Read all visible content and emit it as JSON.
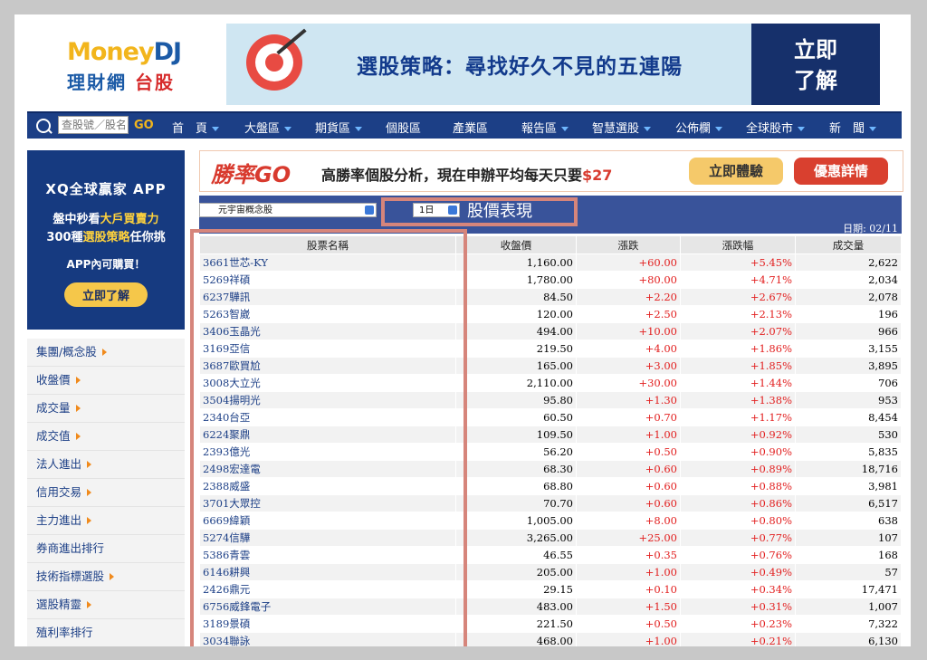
{
  "logo": {
    "money": "Money",
    "dj": "DJ",
    "line2": "理財網",
    "line2b": "台股"
  },
  "banner": {
    "text": "選股策略：尋找好久不見的五連陽",
    "cta": "立即了解"
  },
  "nav": {
    "search_placeholder": "查股號／股名",
    "go": "GO",
    "items": [
      "首　頁",
      "大盤區",
      "期貨區",
      "個股區",
      "產業區",
      "報告區",
      "智慧選股",
      "公佈欄",
      "全球股市",
      "新　聞"
    ]
  },
  "side_ad": {
    "t1": "XQ全球贏家 APP",
    "t2a": "盤中秒看",
    "t2b": "大戶買賣力",
    "t3a": "300種",
    "t3b": "選股策略",
    "t3c": "任你挑",
    "t4": "APP內可購買！",
    "cta": "立即了解"
  },
  "side_menu": [
    "集團/概念股",
    "收盤價",
    "成交量",
    "成交值",
    "法人進出",
    "信用交易",
    "主力進出",
    "券商進出排行",
    "技術指標選股",
    "選股精靈",
    "殖利率排行"
  ],
  "promo": {
    "logo": "勝率GO",
    "text_a": "高勝率個股分析，現在申辦平均每天只要",
    "text_b": "$27",
    "btn1": "立即體驗",
    "btn2": "優惠詳情"
  },
  "table": {
    "concept": "元宇宙概念股",
    "period": "1日",
    "title": "股價表現",
    "date": "日期: 02/11",
    "headers": [
      "股票名稱",
      "收盤價",
      "漲跌",
      "漲跌幅",
      "成交量"
    ],
    "rows": [
      [
        "3661世芯-KY",
        "1,160.00",
        "+60.00",
        "+5.45%",
        "2,622"
      ],
      [
        "5269祥碩",
        "1,780.00",
        "+80.00",
        "+4.71%",
        "2,034"
      ],
      [
        "6237驊訊",
        "84.50",
        "+2.20",
        "+2.67%",
        "2,078"
      ],
      [
        "5263智崴",
        "120.00",
        "+2.50",
        "+2.13%",
        "196"
      ],
      [
        "3406玉晶光",
        "494.00",
        "+10.00",
        "+2.07%",
        "966"
      ],
      [
        "3169亞信",
        "219.50",
        "+4.00",
        "+1.86%",
        "3,155"
      ],
      [
        "3687歐買尬",
        "165.00",
        "+3.00",
        "+1.85%",
        "3,895"
      ],
      [
        "3008大立光",
        "2,110.00",
        "+30.00",
        "+1.44%",
        "706"
      ],
      [
        "3504揚明光",
        "95.80",
        "+1.30",
        "+1.38%",
        "953"
      ],
      [
        "2340台亞",
        "60.50",
        "+0.70",
        "+1.17%",
        "8,454"
      ],
      [
        "6224聚鼎",
        "109.50",
        "+1.00",
        "+0.92%",
        "530"
      ],
      [
        "2393億光",
        "56.20",
        "+0.50",
        "+0.90%",
        "5,835"
      ],
      [
        "2498宏達電",
        "68.30",
        "+0.60",
        "+0.89%",
        "18,716"
      ],
      [
        "2388威盛",
        "68.80",
        "+0.60",
        "+0.88%",
        "3,981"
      ],
      [
        "3701大眾控",
        "70.70",
        "+0.60",
        "+0.86%",
        "6,517"
      ],
      [
        "6669緯穎",
        "1,005.00",
        "+8.00",
        "+0.80%",
        "638"
      ],
      [
        "5274信驊",
        "3,265.00",
        "+25.00",
        "+0.77%",
        "107"
      ],
      [
        "5386青雲",
        "46.55",
        "+0.35",
        "+0.76%",
        "168"
      ],
      [
        "6146耕興",
        "205.00",
        "+1.00",
        "+0.49%",
        "57"
      ],
      [
        "2426鼎元",
        "29.15",
        "+0.10",
        "+0.34%",
        "17,471"
      ],
      [
        "6756威鋒電子",
        "483.00",
        "+1.50",
        "+0.31%",
        "1,007"
      ],
      [
        "3189景碩",
        "221.50",
        "+0.50",
        "+0.23%",
        "7,322"
      ],
      [
        "3034聯詠",
        "468.00",
        "+1.00",
        "+0.21%",
        "6,130"
      ]
    ]
  }
}
